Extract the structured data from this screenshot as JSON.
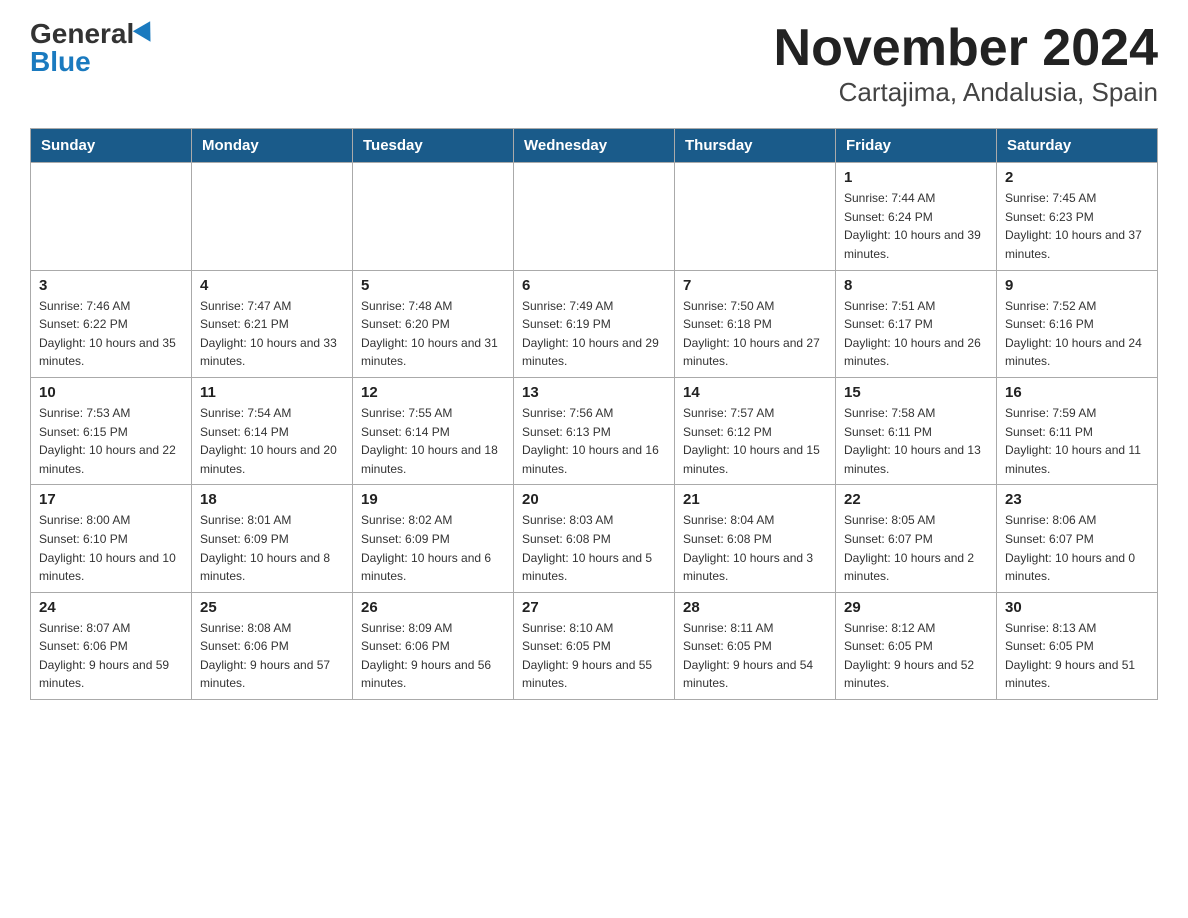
{
  "header": {
    "logo_general": "General",
    "logo_blue": "Blue",
    "month_title": "November 2024",
    "location": "Cartajima, Andalusia, Spain"
  },
  "weekdays": [
    "Sunday",
    "Monday",
    "Tuesday",
    "Wednesday",
    "Thursday",
    "Friday",
    "Saturday"
  ],
  "weeks": [
    [
      {
        "day": "",
        "info": ""
      },
      {
        "day": "",
        "info": ""
      },
      {
        "day": "",
        "info": ""
      },
      {
        "day": "",
        "info": ""
      },
      {
        "day": "",
        "info": ""
      },
      {
        "day": "1",
        "info": "Sunrise: 7:44 AM\nSunset: 6:24 PM\nDaylight: 10 hours and 39 minutes."
      },
      {
        "day": "2",
        "info": "Sunrise: 7:45 AM\nSunset: 6:23 PM\nDaylight: 10 hours and 37 minutes."
      }
    ],
    [
      {
        "day": "3",
        "info": "Sunrise: 7:46 AM\nSunset: 6:22 PM\nDaylight: 10 hours and 35 minutes."
      },
      {
        "day": "4",
        "info": "Sunrise: 7:47 AM\nSunset: 6:21 PM\nDaylight: 10 hours and 33 minutes."
      },
      {
        "day": "5",
        "info": "Sunrise: 7:48 AM\nSunset: 6:20 PM\nDaylight: 10 hours and 31 minutes."
      },
      {
        "day": "6",
        "info": "Sunrise: 7:49 AM\nSunset: 6:19 PM\nDaylight: 10 hours and 29 minutes."
      },
      {
        "day": "7",
        "info": "Sunrise: 7:50 AM\nSunset: 6:18 PM\nDaylight: 10 hours and 27 minutes."
      },
      {
        "day": "8",
        "info": "Sunrise: 7:51 AM\nSunset: 6:17 PM\nDaylight: 10 hours and 26 minutes."
      },
      {
        "day": "9",
        "info": "Sunrise: 7:52 AM\nSunset: 6:16 PM\nDaylight: 10 hours and 24 minutes."
      }
    ],
    [
      {
        "day": "10",
        "info": "Sunrise: 7:53 AM\nSunset: 6:15 PM\nDaylight: 10 hours and 22 minutes."
      },
      {
        "day": "11",
        "info": "Sunrise: 7:54 AM\nSunset: 6:14 PM\nDaylight: 10 hours and 20 minutes."
      },
      {
        "day": "12",
        "info": "Sunrise: 7:55 AM\nSunset: 6:14 PM\nDaylight: 10 hours and 18 minutes."
      },
      {
        "day": "13",
        "info": "Sunrise: 7:56 AM\nSunset: 6:13 PM\nDaylight: 10 hours and 16 minutes."
      },
      {
        "day": "14",
        "info": "Sunrise: 7:57 AM\nSunset: 6:12 PM\nDaylight: 10 hours and 15 minutes."
      },
      {
        "day": "15",
        "info": "Sunrise: 7:58 AM\nSunset: 6:11 PM\nDaylight: 10 hours and 13 minutes."
      },
      {
        "day": "16",
        "info": "Sunrise: 7:59 AM\nSunset: 6:11 PM\nDaylight: 10 hours and 11 minutes."
      }
    ],
    [
      {
        "day": "17",
        "info": "Sunrise: 8:00 AM\nSunset: 6:10 PM\nDaylight: 10 hours and 10 minutes."
      },
      {
        "day": "18",
        "info": "Sunrise: 8:01 AM\nSunset: 6:09 PM\nDaylight: 10 hours and 8 minutes."
      },
      {
        "day": "19",
        "info": "Sunrise: 8:02 AM\nSunset: 6:09 PM\nDaylight: 10 hours and 6 minutes."
      },
      {
        "day": "20",
        "info": "Sunrise: 8:03 AM\nSunset: 6:08 PM\nDaylight: 10 hours and 5 minutes."
      },
      {
        "day": "21",
        "info": "Sunrise: 8:04 AM\nSunset: 6:08 PM\nDaylight: 10 hours and 3 minutes."
      },
      {
        "day": "22",
        "info": "Sunrise: 8:05 AM\nSunset: 6:07 PM\nDaylight: 10 hours and 2 minutes."
      },
      {
        "day": "23",
        "info": "Sunrise: 8:06 AM\nSunset: 6:07 PM\nDaylight: 10 hours and 0 minutes."
      }
    ],
    [
      {
        "day": "24",
        "info": "Sunrise: 8:07 AM\nSunset: 6:06 PM\nDaylight: 9 hours and 59 minutes."
      },
      {
        "day": "25",
        "info": "Sunrise: 8:08 AM\nSunset: 6:06 PM\nDaylight: 9 hours and 57 minutes."
      },
      {
        "day": "26",
        "info": "Sunrise: 8:09 AM\nSunset: 6:06 PM\nDaylight: 9 hours and 56 minutes."
      },
      {
        "day": "27",
        "info": "Sunrise: 8:10 AM\nSunset: 6:05 PM\nDaylight: 9 hours and 55 minutes."
      },
      {
        "day": "28",
        "info": "Sunrise: 8:11 AM\nSunset: 6:05 PM\nDaylight: 9 hours and 54 minutes."
      },
      {
        "day": "29",
        "info": "Sunrise: 8:12 AM\nSunset: 6:05 PM\nDaylight: 9 hours and 52 minutes."
      },
      {
        "day": "30",
        "info": "Sunrise: 8:13 AM\nSunset: 6:05 PM\nDaylight: 9 hours and 51 minutes."
      }
    ]
  ]
}
